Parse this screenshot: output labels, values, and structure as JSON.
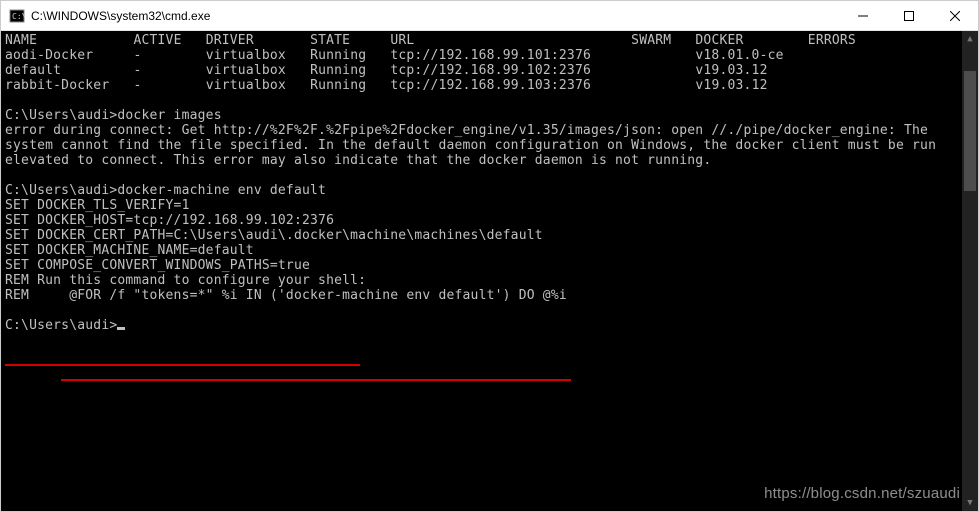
{
  "window": {
    "title": "C:\\WINDOWS\\system32\\cmd.exe"
  },
  "table": {
    "headers": [
      "NAME",
      "ACTIVE",
      "DRIVER",
      "STATE",
      "URL",
      "SWARM",
      "DOCKER",
      "ERRORS"
    ],
    "rows": [
      {
        "name": "aodi-Docker",
        "active": "-",
        "driver": "virtualbox",
        "state": "Running",
        "url": "tcp://192.168.99.101:2376",
        "swarm": "",
        "docker": "v18.01.0-ce",
        "errors": ""
      },
      {
        "name": "default",
        "active": "-",
        "driver": "virtualbox",
        "state": "Running",
        "url": "tcp://192.168.99.102:2376",
        "swarm": "",
        "docker": "v19.03.12",
        "errors": ""
      },
      {
        "name": "rabbit-Docker",
        "active": "-",
        "driver": "virtualbox",
        "state": "Running",
        "url": "tcp://192.168.99.103:2376",
        "swarm": "",
        "docker": "v19.03.12",
        "errors": ""
      }
    ]
  },
  "prompts": {
    "p1": "C:\\Users\\audi>",
    "c1": "docker images",
    "err": "error during connect: Get http://%2F%2F.%2Fpipe%2Fdocker_engine/v1.35/images/json: open //./pipe/docker_engine: The system cannot find the file specified. In the default daemon configuration on Windows, the docker client must be run elevated to connect. This error may also indicate that the docker daemon is not running.",
    "p2": "C:\\Users\\audi>",
    "c2": "docker-machine env default",
    "env1": "SET DOCKER_TLS_VERIFY=1",
    "env2": "SET DOCKER_HOST=tcp://192.168.99.102:2376",
    "env3": "SET DOCKER_CERT_PATH=C:\\Users\\audi\\.docker\\machine\\machines\\default",
    "env4": "SET DOCKER_MACHINE_NAME=default",
    "env5": "SET COMPOSE_CONVERT_WINDOWS_PATHS=true",
    "rem1": "REM Run this command to configure your shell:",
    "rem2": "REM     @FOR /f \"tokens=*\" %i IN ('docker-machine env default') DO @%i",
    "p3": "C:\\Users\\audi>"
  },
  "watermark": "https://blog.csdn.net/szuaudi"
}
